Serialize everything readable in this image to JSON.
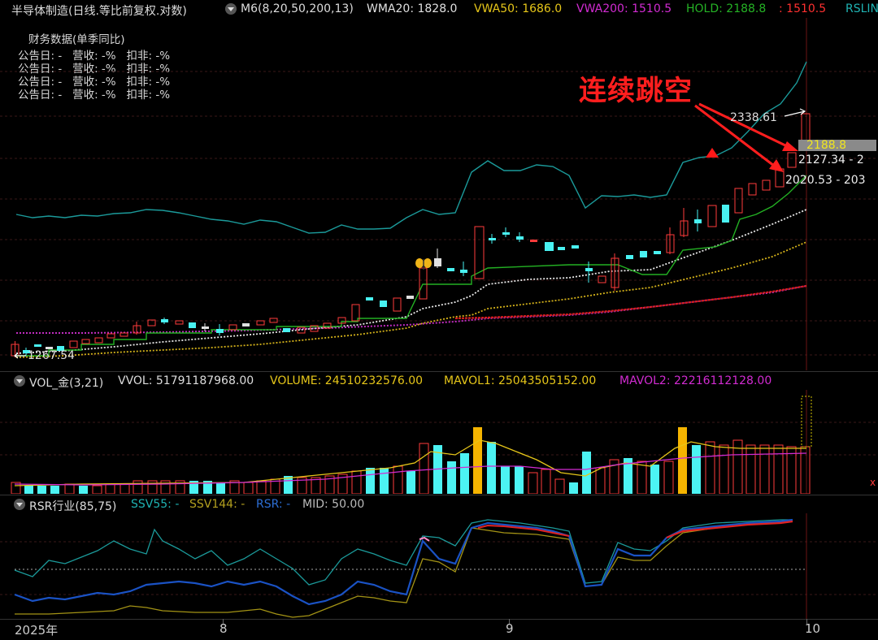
{
  "header": {
    "title": "半导体制造(日线.等比前复权.对数)",
    "m6": "M6(8,20,50,200,13)",
    "wma20": "WMA20: 1828.0",
    "vwa50": "VWA50: 1686.0",
    "vwa200": "VWA200: 1510.5",
    "hold": "HOLD: 2188.8",
    "hold_extra": ": 1510.5",
    "rslin": "RSLIN",
    "colors": {
      "wma20": "#e0e0e0",
      "vwa50": "#e6c619",
      "vwa200": "#d22bd2",
      "hold": "#25b325",
      "rslin": "#1fb3b3",
      "red": "#ff3030"
    }
  },
  "finance": {
    "title": "财务数据(单季同比)",
    "rows": [
      "公告日: -   营收: -%   扣非: -%",
      "公告日: -   营收: -%   扣非: -%",
      "公告日: -   营收: -%   扣非: -%",
      "公告日: -   营收: -%   扣非: -%"
    ]
  },
  "annotation": {
    "text": "连续跳空",
    "color": "#ff1e1e"
  },
  "price_labels": {
    "high": "2338.61",
    "hold_tag": "2188.8",
    "p1": "2127.34 - 2",
    "p2": "2020.53 - 203",
    "low": "1267.54"
  },
  "volume_panel": {
    "vol_label": "VOL_金(3,21)",
    "vvol": "VVOL: 51791187968.00",
    "volume": "VOLUME: 24510232576.00",
    "mavol1": "MAVOL1: 25043505152.00",
    "mavol2": "MAVOL2: 22216112128.00",
    "colors": {
      "volume": "#e6c619",
      "mavol1": "#e6c619",
      "mavol2": "#d22bd2"
    }
  },
  "rsr_panel": {
    "label": "RSR行业(85,75)",
    "ssv55": "SSV55: -",
    "ssv144": "SSV144: -",
    "rsr": "RSR: -",
    "mid": "MID: 50.00",
    "colors": {
      "ssv55": "#1fb3b3",
      "ssv144": "#b3a01f",
      "rsr": "#2d6fd6",
      "mid": "#bbbbbb"
    }
  },
  "x_axis": {
    "labels": [
      "2025年",
      "8",
      "9",
      "10"
    ]
  },
  "icons": [
    "dropdown-circle-icon",
    "butterfly-icon",
    "triangle-marker-icon",
    "arrow-icon"
  ]
}
